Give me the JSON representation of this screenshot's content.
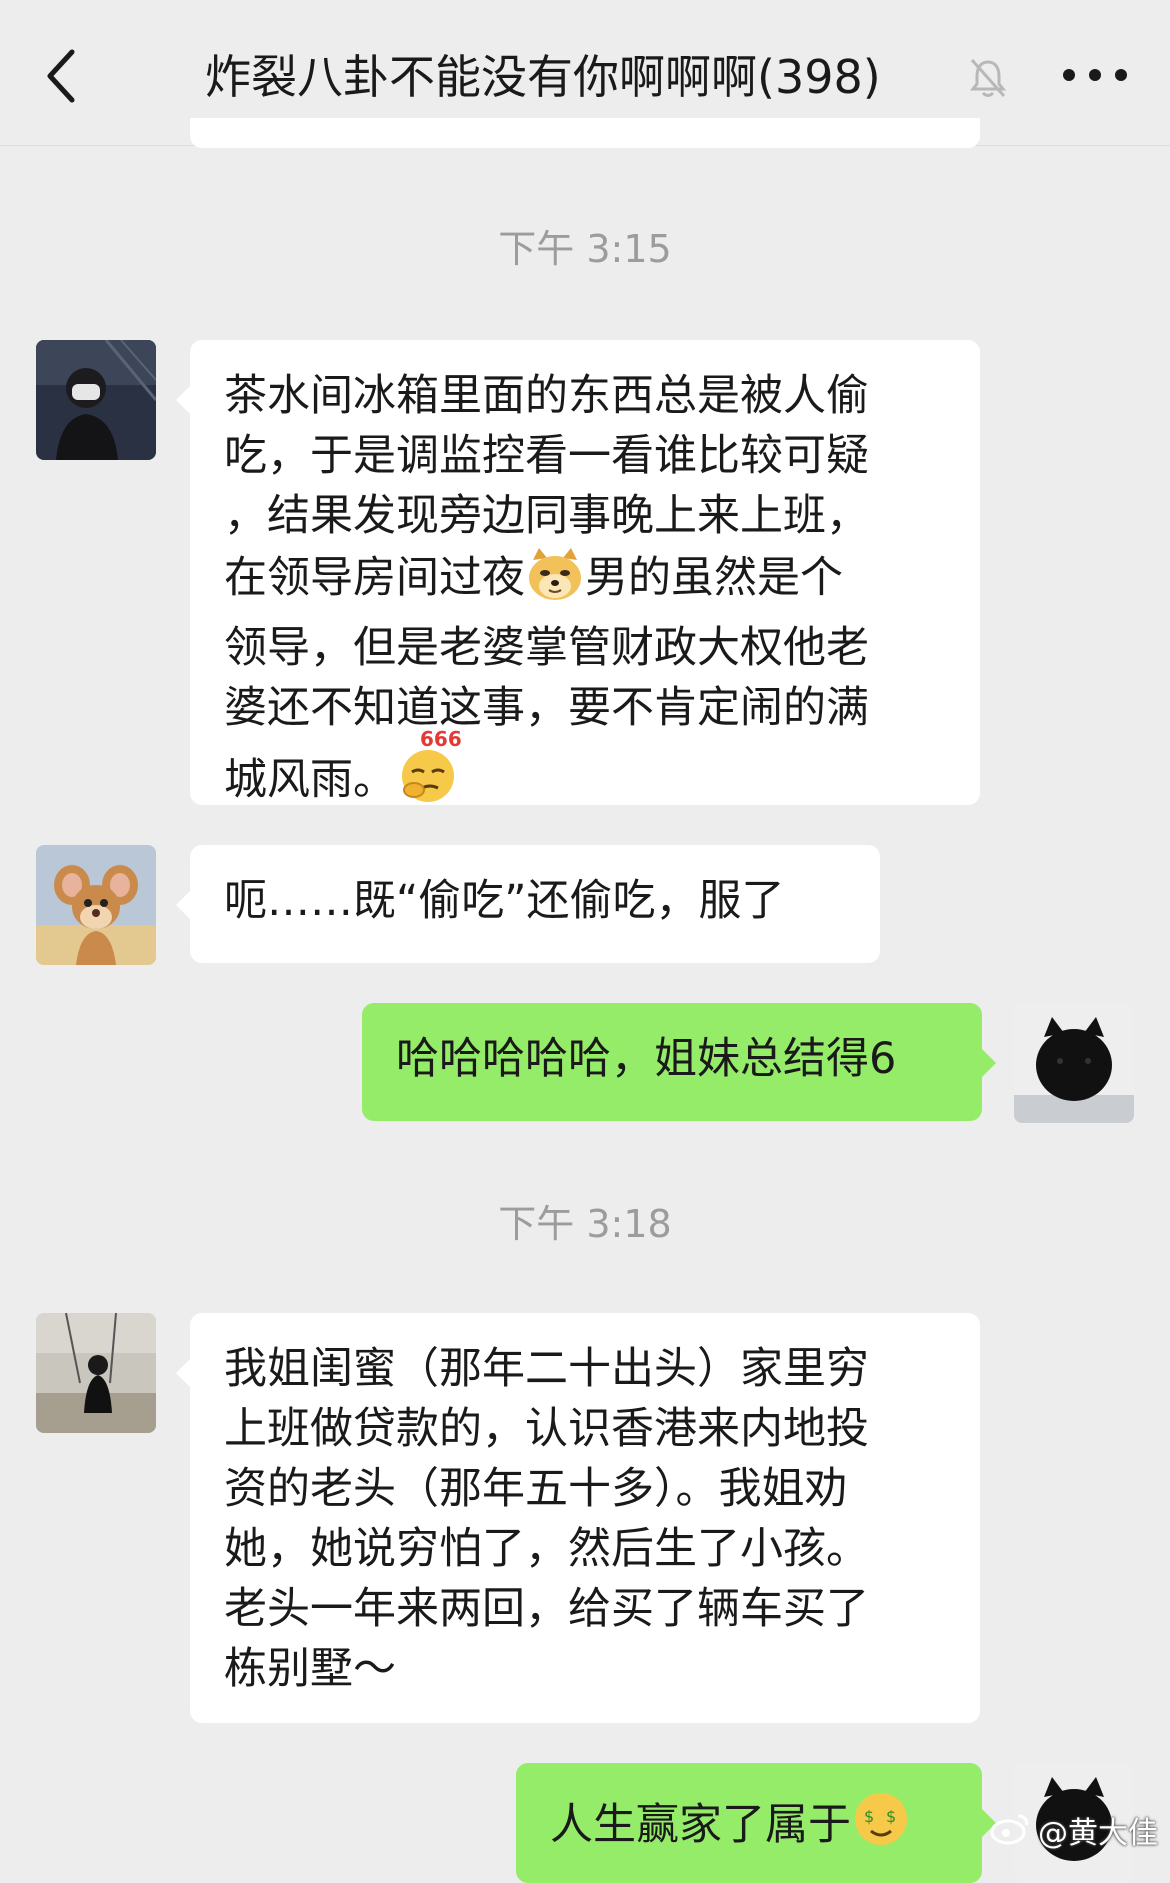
{
  "header": {
    "title": "炸裂八卦不能没有你啊啊啊(398)"
  },
  "timestamps": [
    "下午 3:15",
    "下午 3:18"
  ],
  "messages": [
    {
      "side": "in",
      "lines": [
        "茶水间冰箱里面的东西总是被人偷",
        "吃，于是调监控看一看谁比较可疑",
        "，结果发现旁边同事晚上来上班，",
        "在领导房间过夜",
        "男的虽然是个",
        "领导，但是老婆掌管财政大权他老",
        "婆还不知道这事，要不肯定闹的满",
        "城风雨。"
      ],
      "emoji_doge_label": "doge-emoji",
      "emoji_666_text": "666"
    },
    {
      "side": "in",
      "text": "呃……既“偷吃”还偷吃，服了"
    },
    {
      "side": "out",
      "text": "哈哈哈哈哈，姐妹总结得6"
    },
    {
      "side": "in",
      "lines": [
        "我姐闺蜜（那年二十出头）家里穷",
        "上班做贷款的，认识香港来内地投",
        "资的老头（那年五十多）。我姐劝",
        "她，她说穷怕了，然后生了小孩。",
        "老头一年来两回，给买了辆车买了",
        "栋别墅～"
      ]
    },
    {
      "side": "out",
      "text": "人生赢家了属于"
    }
  ],
  "watermark": "@黄大佳",
  "colors": {
    "background": "#ededed",
    "incoming_bubble": "#ffffff",
    "outgoing_bubble": "#95ec69",
    "timestamp": "#9c9c9c"
  }
}
